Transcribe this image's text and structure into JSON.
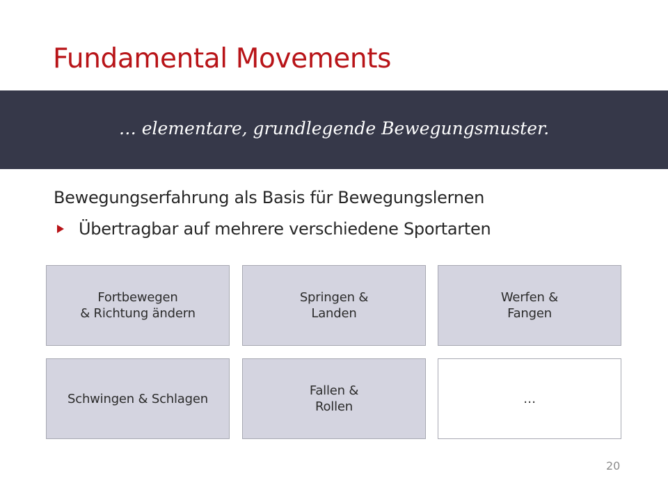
{
  "slide": {
    "title": "Fundamental Movements",
    "subtitle": "… elementare, grundlegende Bewegungsmuster.",
    "heading": "Bewegungserfahrung als Basis für Bewegungslernen",
    "bullet": "Übertragbar auf mehrere verschiedene Sportarten",
    "boxes": [
      {
        "label": "Fortbewegen\n& Richtung ändern"
      },
      {
        "label": "Springen &\nLanden"
      },
      {
        "label": "Werfen &\nFangen"
      },
      {
        "label": "Schwingen & Schlagen"
      },
      {
        "label": "Fallen &\nRollen"
      },
      {
        "label": "…"
      }
    ],
    "page_number": "20"
  },
  "colors": {
    "title": "#b81418",
    "banner": "#363849",
    "box_fill": "#d4d4e0",
    "box_border": "#a7a8b2",
    "bullet": "#b81418"
  },
  "icons": {
    "bullet": "triangle-right-icon"
  }
}
